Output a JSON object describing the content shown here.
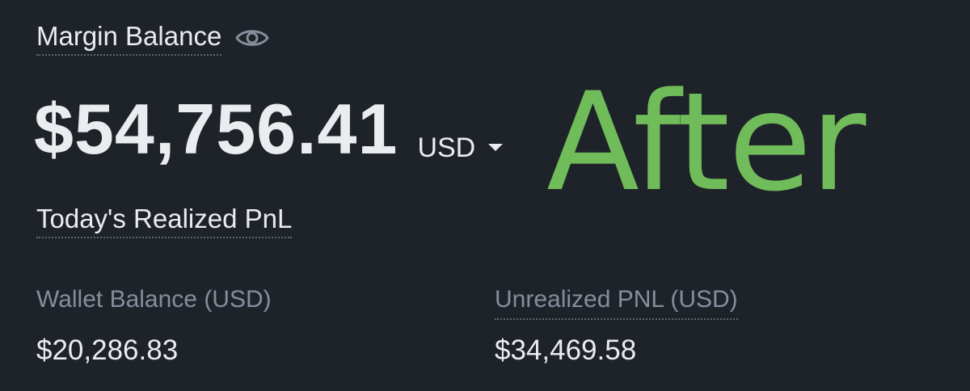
{
  "margin_balance": {
    "label": "Margin Balance",
    "icon": "eye-icon",
    "value": "$54,756.41",
    "currency": "USD",
    "currency_icon": "caret-down-icon"
  },
  "overlay": {
    "text": "After",
    "color": "#70bb5a"
  },
  "todays_realized_pnl": {
    "label": "Today's Realized PnL"
  },
  "wallet_balance": {
    "label": "Wallet Balance (USD)",
    "value": "$20,286.83"
  },
  "unrealized_pnl": {
    "label": "Unrealized PNL (USD)",
    "value": "$34,469.58"
  },
  "colors": {
    "background": "#1e2329",
    "primary_text": "#eaecef",
    "secondary_text": "#848e9c"
  }
}
